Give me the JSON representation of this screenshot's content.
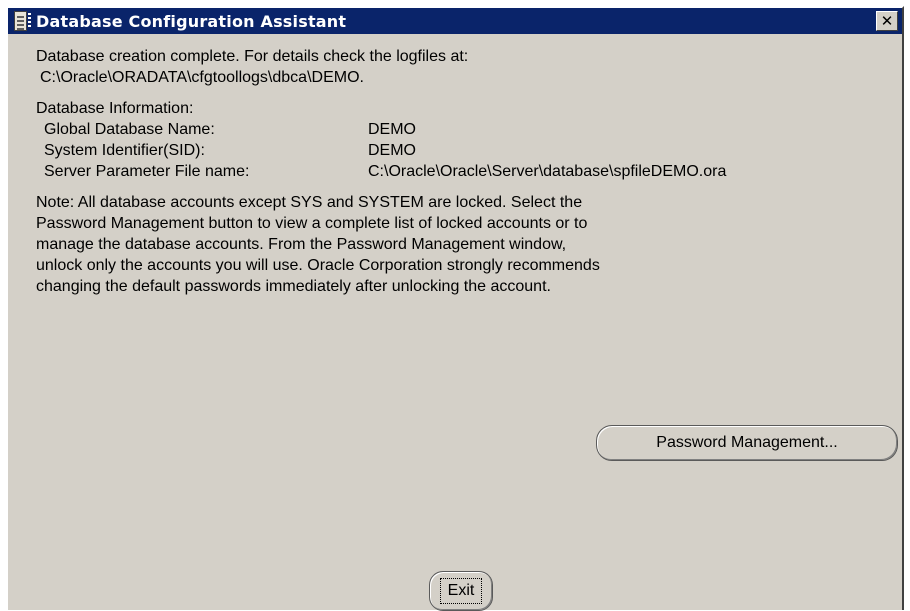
{
  "window": {
    "title": "Database Configuration Assistant",
    "close_glyph": "✕",
    "icon": "database-icon"
  },
  "completion": {
    "line1": "Database creation complete. For details check the logfiles at:",
    "line2": "C:\\Oracle\\ORADATA\\cfgtoollogs\\dbca\\DEMO."
  },
  "info": {
    "heading": "Database Information:",
    "rows": [
      {
        "label": "Global Database Name:",
        "value": "DEMO"
      },
      {
        "label": "System Identifier(SID):",
        "value": "DEMO"
      },
      {
        "label": "Server Parameter File name:",
        "value": "C:\\Oracle\\Oracle\\Server\\database\\spfileDEMO.ora"
      }
    ]
  },
  "note": {
    "lines": [
      "Note: All database accounts except SYS and SYSTEM are locked. Select the",
      "Password Management button to view a complete list of locked accounts or to",
      "manage the database accounts. From the Password Management window,",
      "unlock only the accounts you will use. Oracle Corporation strongly recommends",
      "changing the default passwords immediately after unlocking the account."
    ]
  },
  "buttons": {
    "password_management": "Password Management...",
    "exit": "Exit"
  }
}
